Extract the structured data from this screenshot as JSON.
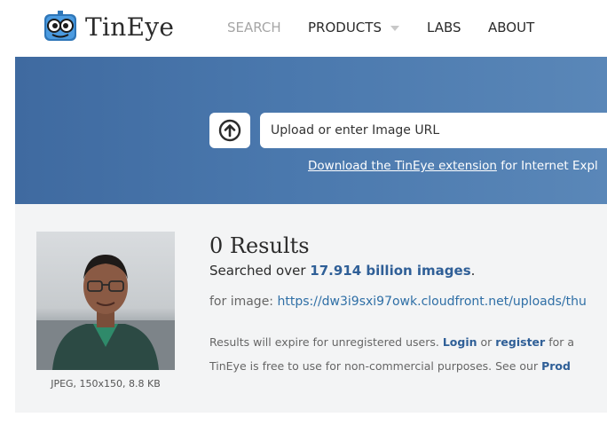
{
  "brand": {
    "name": "TinEye",
    "icon": "tineye-robot-icon"
  },
  "nav": {
    "search": "SEARCH",
    "products": "PRODUCTS",
    "labs": "LABS",
    "about": "ABOUT"
  },
  "search": {
    "placeholder": "Upload or enter Image URL",
    "extension_link": "Download the TinEye extension",
    "extension_suffix": "for Internet Expl"
  },
  "results": {
    "count_label": "0 Results",
    "searched_prefix": "Searched over",
    "searched_count": "17.914 billion images",
    "searched_suffix": ".",
    "for_image_label": "for image:",
    "image_url": "https://dw3i9sxi97owk.cloudfront.net/uploads/thu",
    "thumb_caption": "JPEG, 150x150, 8.8 KB",
    "note1_prefix": "Results will expire for unregistered users.",
    "login": "Login",
    "or": "or",
    "register": "register",
    "note1_suffix": "for a",
    "note2_prefix": "TinEye is free to use for non-commercial purposes. See our",
    "note2_link": "Prod"
  },
  "colors": {
    "banner": "#4a78ad",
    "link": "#2f5f97",
    "results_bg": "#f3f4f5"
  }
}
